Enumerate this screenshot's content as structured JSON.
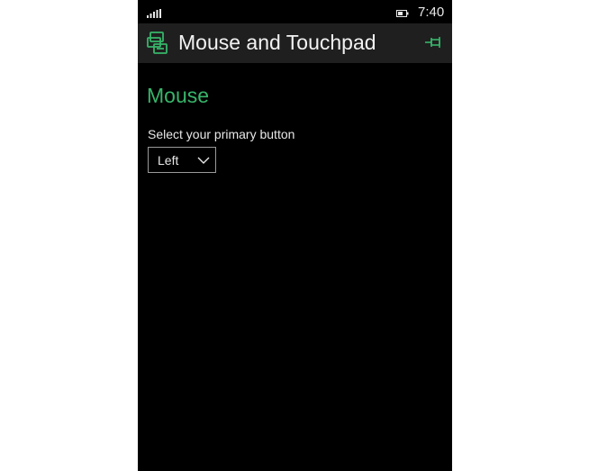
{
  "status_bar": {
    "time": "7:40",
    "signal_icon": "signal-icon",
    "battery_icon": "battery-icon"
  },
  "header": {
    "title": "Mouse and Touchpad",
    "app_icon": "mouse-settings-icon",
    "pin_icon": "pin-icon"
  },
  "section": {
    "title": "Mouse"
  },
  "primary_button": {
    "label": "Select your primary button",
    "value": "Left"
  },
  "colors": {
    "accent": "#37b56a",
    "background": "#000000",
    "header_background": "#1f1f1f"
  }
}
